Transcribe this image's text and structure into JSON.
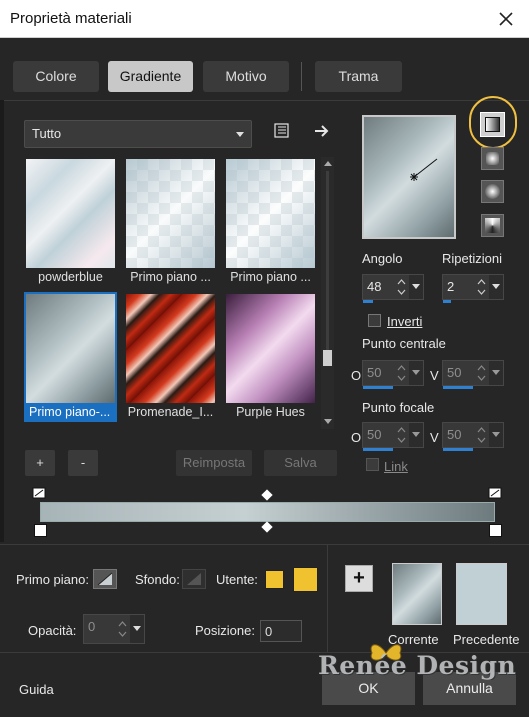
{
  "window": {
    "title": "Proprietà materiali"
  },
  "tabs": [
    {
      "label": "Colore"
    },
    {
      "label": "Gradiente"
    },
    {
      "label": "Motivo"
    },
    {
      "label": "Trama"
    }
  ],
  "active_tab": "Gradiente",
  "category_dropdown": {
    "value": "Tutto"
  },
  "thumbnails": [
    {
      "label": "powderblue"
    },
    {
      "label": "Primo piano ..."
    },
    {
      "label": "Primo piano ..."
    },
    {
      "label": "Primo piano-..."
    },
    {
      "label": "Promenade_I..."
    },
    {
      "label": "Purple Hues"
    }
  ],
  "list_buttons": {
    "add": "+",
    "remove": "-",
    "reset": "Reimposta",
    "save": "Salva"
  },
  "gradient_settings": {
    "angle_label": "Angolo",
    "angle_value": "48",
    "repeat_label": "Ripetizioni",
    "repeat_value": "2",
    "invert_label": "Inverti",
    "center_label": "Punto centrale",
    "center_h_label": "O",
    "center_h": "50",
    "center_v_label": "V",
    "center_v": "50",
    "focal_label": "Punto focale",
    "focal_h_label": "O",
    "focal_h": "50",
    "focal_v_label": "V",
    "focal_v": "50",
    "link_label": "Link"
  },
  "bottom": {
    "foreground_label": "Primo piano:",
    "background_label": "Sfondo:",
    "user_label": "Utente:",
    "user_color": "#f1c230",
    "opacity_label": "Opacità:",
    "opacity_value": "0",
    "position_label": "Posizione:",
    "position_value": "0",
    "current_label": "Corrente",
    "previous_label": "Precedente",
    "add_button": "+"
  },
  "footer": {
    "help_label": "Guida",
    "ok_label": "OK",
    "cancel_label": "Annulla",
    "watermark": "Renée Design"
  }
}
